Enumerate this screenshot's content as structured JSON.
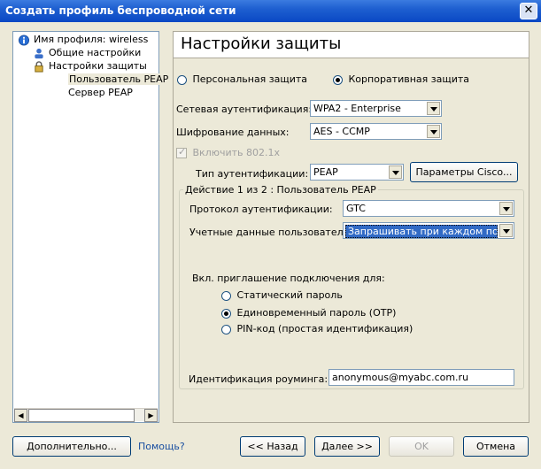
{
  "window": {
    "title": "Создать профиль беспроводной сети",
    "close_symbol": "✕"
  },
  "tree": {
    "items": [
      {
        "label": "Имя профиля: wireless"
      },
      {
        "label": "Общие настройки"
      },
      {
        "label": "Настройки защиты"
      },
      {
        "label": "Пользователь PEAP"
      },
      {
        "label": "Сервер PEAP"
      }
    ],
    "scroll_left": "◀",
    "scroll_right": "▶"
  },
  "main": {
    "heading": "Настройки защиты",
    "radio_personal": "Персональная защита",
    "radio_corporate": "Корпоративная защита",
    "net_auth_label": "Сетевая аутентификация:",
    "net_auth_value": "WPA2 - Enterprise",
    "encryption_label": "Шифрование данных:",
    "encryption_value": "AES - CCMP",
    "enable_8021x": "Включить 802.1x",
    "auth_type_label": "Тип аутентификации:",
    "auth_type_value": "PEAP",
    "cisco_button": "Параметры Cisco...",
    "group_title": "Действие 1 из 2 : Пользователь PEAP",
    "protocol_label": "Протокол аутентификации:",
    "protocol_value": "GTC",
    "credentials_label": "Учетные данные пользователя:",
    "credentials_value": "Запрашивать при каждом подклю",
    "prompt_label": "Вкл. приглашение подключения для:",
    "option_static": "Статический пароль",
    "option_otp": "Единовременный пароль (OTP)",
    "option_pin": "PIN-код (простая идентификация)",
    "roaming_label": "Идентификация роуминга:",
    "roaming_value": "anonymous@myabc.com.ru"
  },
  "footer": {
    "advanced": "Дополнительно...",
    "help": "Помощь?",
    "back": "<< Назад",
    "next": "Далее >>",
    "ok": "OK",
    "cancel": "Отмена"
  },
  "colors": {
    "titlebar": "#0a48c4",
    "dialog_bg": "#ece9d8",
    "selection": "#316ac5"
  }
}
